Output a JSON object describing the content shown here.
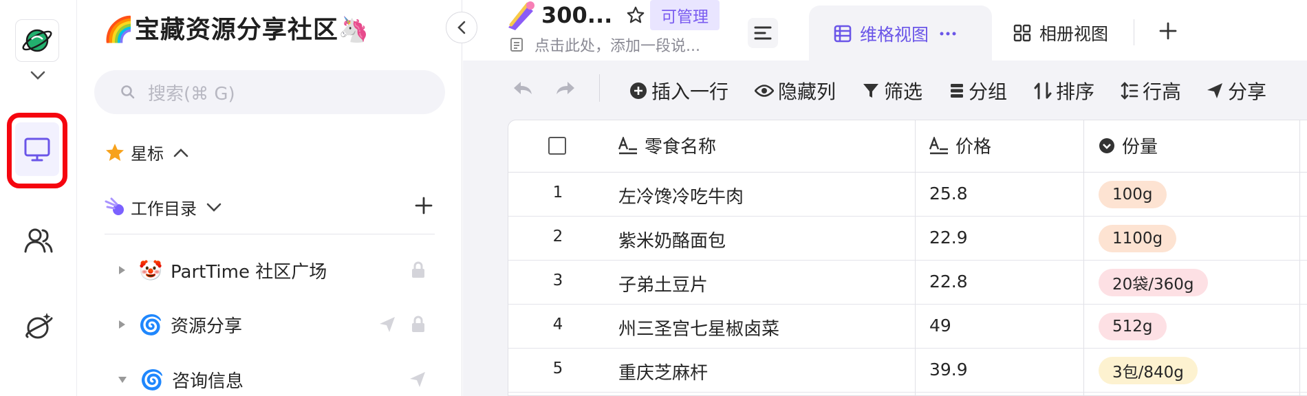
{
  "workspace": {
    "title": "🌈宝藏资源分享社区🦄"
  },
  "search": {
    "placeholder": "搜索(⌘ G)"
  },
  "starred": {
    "label": "星标"
  },
  "work_dir": {
    "label": "工作目录"
  },
  "tree": [
    {
      "emoji": "🤡",
      "label": "PartTime 社区广场",
      "expanded": false,
      "shared": false,
      "locked": true
    },
    {
      "emoji": "🌀",
      "label": "资源分享",
      "expanded": false,
      "shared": true,
      "locked": true
    },
    {
      "emoji": "🌀",
      "label": "咨询信息",
      "expanded": true,
      "shared": true,
      "locked": false
    }
  ],
  "doc": {
    "emoji": "☄️",
    "title": "300...",
    "permission": "可管理",
    "description_placeholder": "点击此处，添加一段说..."
  },
  "views": {
    "active": "维格视图",
    "second": "相册视图"
  },
  "toolbar": {
    "insert_row": "插入一行",
    "hide_cols": "隐藏列",
    "filter": "筛选",
    "group": "分组",
    "sort": "排序",
    "row_height": "行高",
    "share": "分享"
  },
  "table": {
    "columns": [
      "零食名称",
      "价格",
      "份量"
    ],
    "rows": [
      {
        "idx": "1",
        "name": "左冷馋冷吃牛肉",
        "price": "25.8",
        "portion": "100g",
        "tag_color": "#fde3d2"
      },
      {
        "idx": "2",
        "name": "紫米奶酪面包",
        "price": "22.9",
        "portion": "1100g",
        "tag_color": "#fde3d2"
      },
      {
        "idx": "3",
        "name": "子弟土豆片",
        "price": "22.8",
        "portion": "20袋/360g",
        "tag_color": "#fde0e4"
      },
      {
        "idx": "4",
        "name": "州三圣宫七星椒卤菜",
        "price": "49",
        "portion": "512g",
        "tag_color": "#fde0e4"
      },
      {
        "idx": "5",
        "name": "重庆芝麻杆",
        "price": "39.9",
        "portion": "3包/840g",
        "tag_color": "#fdf2d0"
      }
    ]
  },
  "colors": {
    "accent": "#6a55e8",
    "highlight": "#f5050f"
  }
}
